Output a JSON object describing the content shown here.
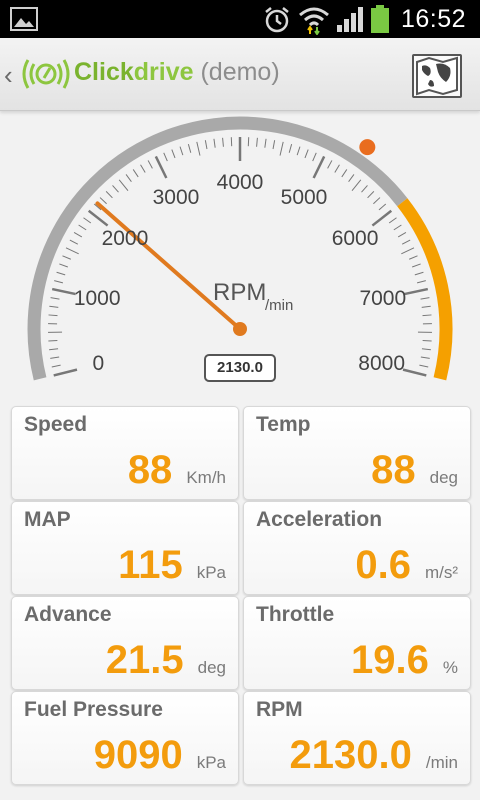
{
  "status_bar": {
    "time": "16:52",
    "icons": [
      "gallery-icon",
      "alarm-icon",
      "wifi-icon",
      "signal-icon",
      "battery-icon"
    ]
  },
  "action_bar": {
    "title_part1": "Click",
    "title_part2": "drive",
    "title_part3": " (demo)",
    "map_button_icon": "map-icon"
  },
  "gauge": {
    "label": "RPM",
    "unit": "/min",
    "readout": "2130.0",
    "value": 2130,
    "min": 0,
    "max": 8000,
    "redline_start": 6000,
    "tick_labels": [
      "0",
      "1000",
      "2000",
      "3000",
      "4000",
      "5000",
      "6000",
      "7000",
      "8000"
    ],
    "colors": {
      "arc": "#a9a9a9",
      "redline": "#f5a000",
      "needle": "#e07a1f",
      "dot": "#e96d1f"
    }
  },
  "tiles": [
    {
      "label": "Speed",
      "value": "88",
      "unit": "Km/h"
    },
    {
      "label": "Temp",
      "value": "88",
      "unit": "deg"
    },
    {
      "label": "MAP",
      "value": "115",
      "unit": "kPa"
    },
    {
      "label": "Acceleration",
      "value": "0.6",
      "unit": "m/s²"
    },
    {
      "label": "Advance",
      "value": "21.5",
      "unit": "deg"
    },
    {
      "label": "Throttle",
      "value": "19.6",
      "unit": "%"
    },
    {
      "label": "Fuel Pressure",
      "value": "9090",
      "unit": "kPa"
    },
    {
      "label": "RPM",
      "value": "2130.0",
      "unit": "/min"
    }
  ]
}
